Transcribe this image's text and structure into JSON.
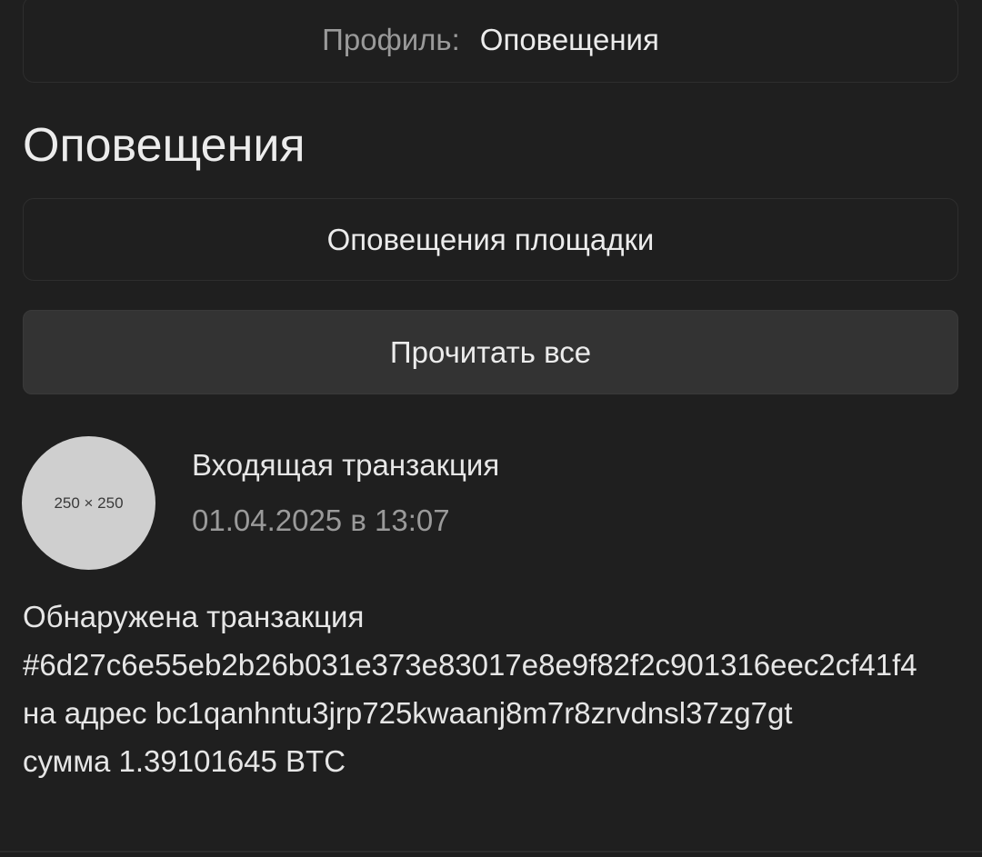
{
  "breadcrumb": {
    "parent": "Профиль:",
    "current": "Оповещения"
  },
  "page_title": "Оповещения",
  "section": {
    "label": "Оповещения площадки"
  },
  "read_all_button": {
    "label": "Прочитать все"
  },
  "notification": {
    "avatar_placeholder": "250 × 250",
    "title": "Входящая транзакция",
    "timestamp": "01.04.2025 в 13:07",
    "body_lines": [
      "Обнаружена транзакция",
      "#6d27c6e55eb2b26b031e373e83017e8e9f82f2c901316eec2cf41f4",
      "на адрес bc1qanhntu3jrp725kwaanj8m7r8zrvdnsl37zg7gt",
      "сумма 1.39101645 BTC"
    ]
  },
  "colors": {
    "background": "#1f1f1f",
    "button_bg": "#333333",
    "muted_text": "#9a9a9a",
    "primary_text": "#ececec",
    "avatar_bg": "#cfcfcf"
  }
}
